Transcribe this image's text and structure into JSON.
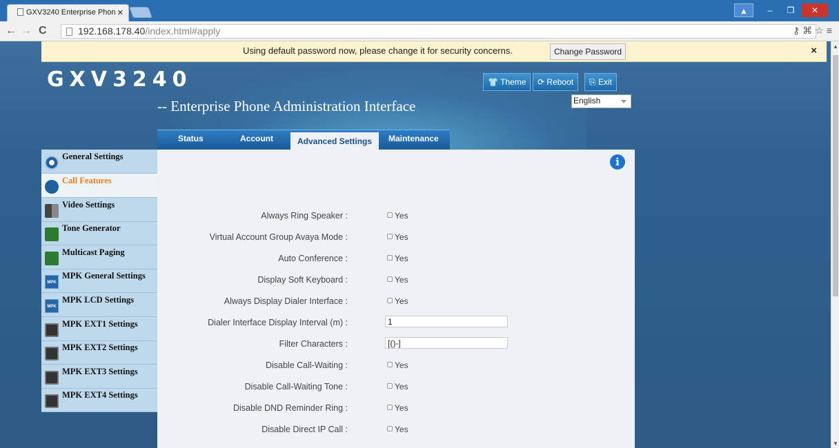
{
  "browser": {
    "tab_title": "GXV3240 Enterprise Phon",
    "url_host": "192.168.178.40",
    "url_path": "/index.html#apply"
  },
  "notice": {
    "message": "Using default password now, please change it for security concerns.",
    "button": "Change Password",
    "close": "×"
  },
  "header": {
    "logo": "GXV3240",
    "subtitle": "-- Enterprise Phone Administration Interface",
    "buttons": {
      "theme": "Theme",
      "reboot": "Reboot",
      "exit": "Exit"
    },
    "language": "English"
  },
  "tabs": {
    "status": "Status",
    "account": "Account",
    "advanced": "Advanced Settings",
    "maintenance": "Maintenance"
  },
  "sidebar": {
    "items": [
      {
        "label": "General Settings",
        "icon": "gear-icon"
      },
      {
        "label": "Call Features",
        "icon": "phone-icon"
      },
      {
        "label": "Video Settings",
        "icon": "video-icon"
      },
      {
        "label": "Tone Generator",
        "icon": "music-note-icon"
      },
      {
        "label": "Multicast Paging",
        "icon": "music-note-icon"
      },
      {
        "label": "MPK General Settings",
        "icon": "mpk-icon"
      },
      {
        "label": "MPK LCD Settings",
        "icon": "mpk-icon"
      },
      {
        "label": "MPK EXT1 Settings",
        "icon": "extension-module-icon"
      },
      {
        "label": "MPK EXT2 Settings",
        "icon": "extension-module-icon"
      },
      {
        "label": "MPK EXT3 Settings",
        "icon": "extension-module-icon"
      },
      {
        "label": "MPK EXT4 Settings",
        "icon": "extension-module-icon"
      }
    ],
    "active": "Call Features"
  },
  "form": {
    "yes": "Yes",
    "rows": [
      {
        "label": "Always Ring Speaker :",
        "type": "checkbox"
      },
      {
        "label": "Virtual Account Group Avaya Mode :",
        "type": "checkbox"
      },
      {
        "label": "Auto Conference :",
        "type": "checkbox"
      },
      {
        "label": "Display Soft Keyboard :",
        "type": "checkbox"
      },
      {
        "label": "Always Display Dialer Interface :",
        "type": "checkbox"
      },
      {
        "label": "Dialer Interface Display Interval (m) :",
        "type": "text",
        "value": "1"
      },
      {
        "label": "Filter Characters :",
        "type": "text",
        "value": "[()-]"
      },
      {
        "label": "Disable Call-Waiting :",
        "type": "checkbox"
      },
      {
        "label": "Disable Call-Waiting Tone :",
        "type": "checkbox"
      },
      {
        "label": "Disable DND Reminder Ring :",
        "type": "checkbox"
      },
      {
        "label": "Disable Direct IP Call :",
        "type": "checkbox"
      }
    ]
  },
  "colors": {
    "accent": "#1d72c9",
    "active_item": "#e67e22",
    "notice_bg": "#fcf3d0"
  }
}
